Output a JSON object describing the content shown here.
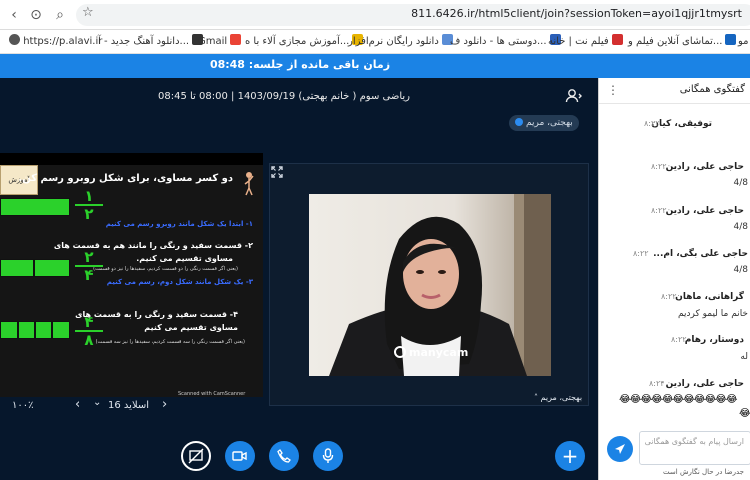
{
  "browser": {
    "url": "811.6426.ir/html5client/join?sessionToken=ayoi1qjjr1tmysrt",
    "bookmarks": [
      {
        "label": "https://p.alavi.ir",
        "color": "#555555"
      },
      {
        "label": "دانلود آهنگ جدید - آ...",
        "color": "#333333"
      },
      {
        "label": "Gmail",
        "color": "#ea4335"
      },
      {
        "label": "آموزش مجازی آلاء با ه...",
        "color": "#e8b400"
      },
      {
        "label": "دانلود رایگان نرم‌افزار",
        "color": "#5a8dd6"
      },
      {
        "label": "دوستی ها - دانلود ف...",
        "color": "#2b5fb8"
      },
      {
        "label": "فیلم نت | خانه",
        "color": "#d32f2f"
      },
      {
        "label": "تماشای آنلاین فیلم و...",
        "color": "#1565c0"
      },
      {
        "label": "مو",
        "color": "#666666"
      }
    ]
  },
  "timer": {
    "text": "زمان باقی مانده از جلسه: 08:48"
  },
  "session": {
    "title": "ریاضی سوم ( خانم بهجتی) 1403/09/19 | 08:00 تا 08:45",
    "presenter_badge": "بهجتی، مریم"
  },
  "slide": {
    "heading": "دو کسر مساوی، برای شکل روبرو رسم کن.",
    "edu_label": "آموزش کسر",
    "step1": "۱- ابتدا یک شکل مانند روبرو رسم می کنیم",
    "step2_line1": "۲- قسمت سفید و رنگی را مانند هم به قسمت های",
    "step2_line2": "مساوی تقسیم می کنیم.",
    "step2_note": "(یعنی اگر قسمت رنگی را دو قسمت کردیم، سفیدها را نیز دو قسمت)",
    "step3": "۳- یک شکل مانند شکل دوم، رسم می کنیم",
    "step4_line1": "۴- قسمت سفید و رنگی را به قسمت های",
    "step4_line2": "مساوی تقسیم می کنیم",
    "step4_note": "(یعنی اگر قسمت رنگی را سه قسمت کردیم، سفیدها را نیز سه قسمت)",
    "frac1_num": "۱",
    "frac1_den": "۲",
    "frac2_num": "۲",
    "frac2_den": "۴",
    "frac3_num": "۴",
    "frac3_den": "۸",
    "scanned": "Scanned with CamScanner"
  },
  "pres_controls": {
    "zoom": "۱۰۰٪",
    "slide_label": "اسلاید 16",
    "chevron_down": "⌄",
    "prev": "‹",
    "next": "›"
  },
  "webcam": {
    "brand": "manycam",
    "name": "بهجتی، مریم"
  },
  "chat": {
    "title": "گفتگوی همگانی",
    "messages": [
      {
        "name": "توفیقی، کیان",
        "time": "۸:۲۲",
        "text": ""
      },
      {
        "name": "حاجی علی، رادین",
        "time": "۸:۲۲",
        "text": "4/8"
      },
      {
        "name": "حاجی علی، رادین",
        "time": "۸:۲۲",
        "text": "4/8"
      },
      {
        "name": "حاجی علی بگی، ام...",
        "time": "۸:۲۲",
        "text": "4/8"
      },
      {
        "name": "گراهانی، ماهان",
        "time": "۸:۲۲",
        "text": "خانم ما لیمو کردیم"
      },
      {
        "name": "دوستار، رهام",
        "time": "۸:۲۲",
        "text": "له"
      },
      {
        "name": "حاجی علی، رادین",
        "time": "۸:۲۴",
        "text": ""
      }
    ],
    "emojis": "😂😂😂😂😂😂😂😂😂😂😂",
    "emojis2": "😂",
    "input_placeholder": "ارسال پیام به گفتگوی همگانی",
    "typing": "جدرضا در حال نگارش است"
  }
}
